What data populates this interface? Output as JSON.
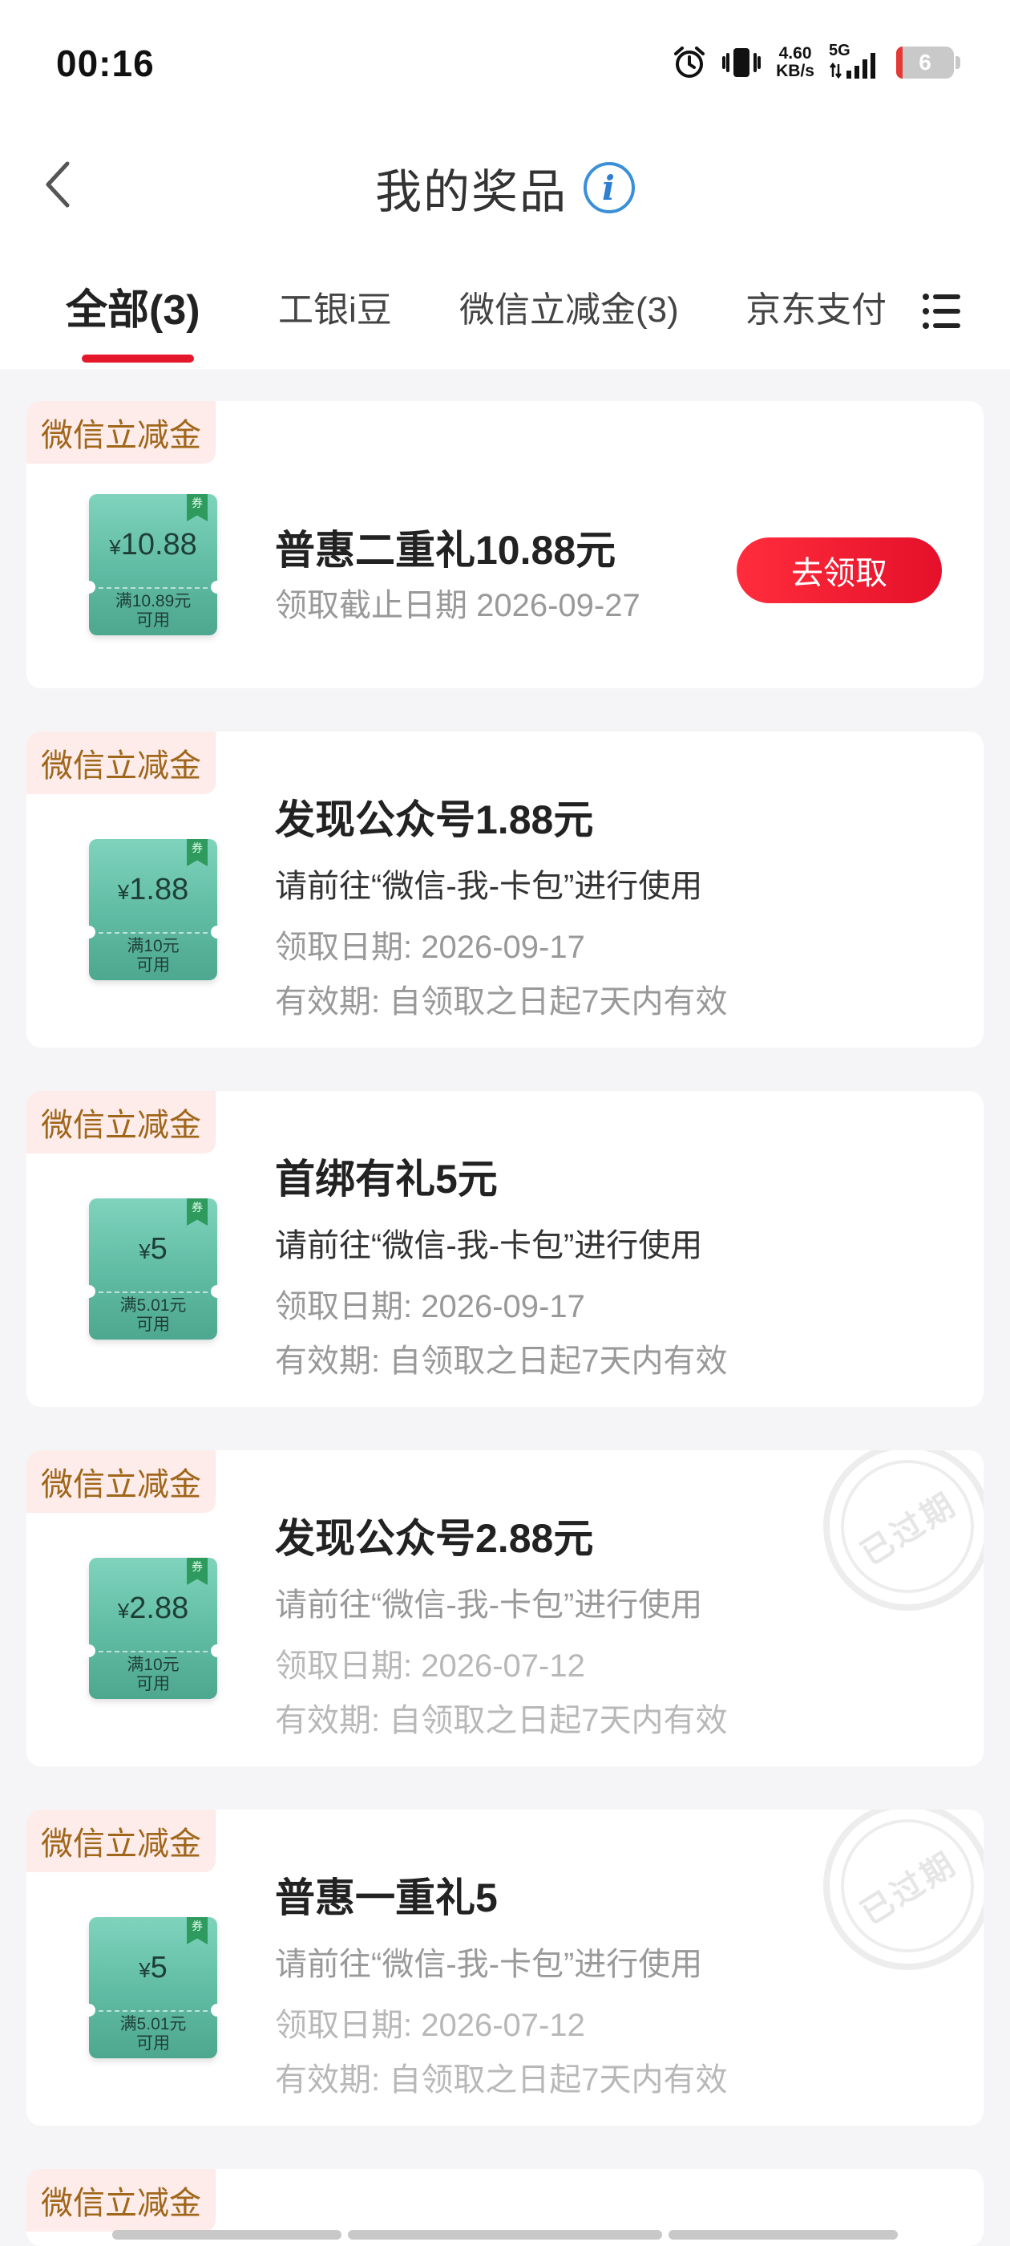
{
  "status_bar": {
    "time": "00:16",
    "net_speed_value": "4.60",
    "net_speed_unit": "KB/s",
    "network": "5G",
    "battery": "6"
  },
  "header": {
    "title": "我的奖品",
    "info_glyph": "i"
  },
  "tabs": [
    {
      "label": "全部(3)",
      "active": true
    },
    {
      "label": "工银i豆",
      "active": false
    },
    {
      "label": "微信立减金(3)",
      "active": false
    },
    {
      "label": "京东支付",
      "active": false
    }
  ],
  "colors": {
    "accent": "#e5172a",
    "coupon_green": "#5fbba2",
    "tag_bg": "#fdecea",
    "tag_text": "#a0661a"
  },
  "prizes": [
    {
      "tag": "微信立减金",
      "coupon_symbol": "¥",
      "coupon_amount": "10.88",
      "coupon_condition_1": "满10.89元",
      "coupon_condition_2": "可用",
      "coupon_flag": "券",
      "title": "普惠二重礼10.88元",
      "deadline": "领取截止日期 2026-09-27",
      "action": "去领取"
    },
    {
      "tag": "微信立减金",
      "coupon_symbol": "¥",
      "coupon_amount": "1.88",
      "coupon_condition_1": "满10元",
      "coupon_condition_2": "可用",
      "coupon_flag": "券",
      "title": "发现公众号1.88元",
      "usage": "请前往“微信-我-卡包”进行使用",
      "claim_date": "领取日期: 2026-09-17",
      "validity": "有效期: 自领取之日起7天内有效"
    },
    {
      "tag": "微信立减金",
      "coupon_symbol": "¥",
      "coupon_amount": "5",
      "coupon_condition_1": "满5.01元",
      "coupon_condition_2": "可用",
      "coupon_flag": "券",
      "title": "首绑有礼5元",
      "usage": "请前往“微信-我-卡包”进行使用",
      "claim_date": "领取日期: 2026-09-17",
      "validity": "有效期: 自领取之日起7天内有效"
    },
    {
      "tag": "微信立减金",
      "coupon_symbol": "¥",
      "coupon_amount": "2.88",
      "coupon_condition_1": "满10元",
      "coupon_condition_2": "可用",
      "coupon_flag": "券",
      "title": "发现公众号2.88元",
      "usage": "请前往“微信-我-卡包”进行使用",
      "claim_date": "领取日期: 2026-07-12",
      "validity": "有效期: 自领取之日起7天内有效",
      "stamp": "已过期"
    },
    {
      "tag": "微信立减金",
      "coupon_symbol": "¥",
      "coupon_amount": "5",
      "coupon_condition_1": "满5.01元",
      "coupon_condition_2": "可用",
      "coupon_flag": "券",
      "title": "普惠一重礼5",
      "usage": "请前往“微信-我-卡包”进行使用",
      "claim_date": "领取日期: 2026-07-12",
      "validity": "有效期: 自领取之日起7天内有效",
      "stamp": "已过期"
    },
    {
      "tag": "微信立减金"
    }
  ]
}
